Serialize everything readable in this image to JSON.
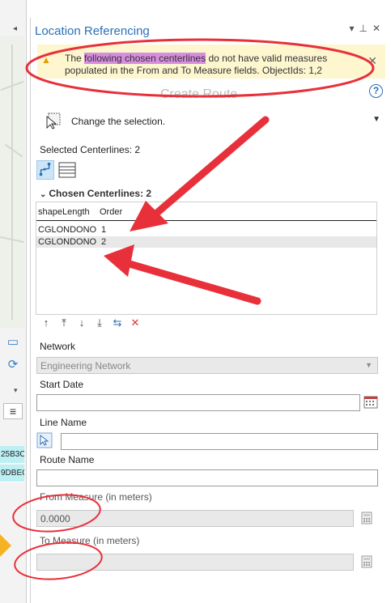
{
  "left_strip": {
    "cyan_rows": [
      "25B3C",
      "9DBEC"
    ]
  },
  "panel": {
    "title": "Location Referencing",
    "title_buttons": "▾ ᵖ ✕",
    "warning": {
      "text_pre": "The ",
      "text_highlight": "following chosen centerlines",
      "text_post": " do not have valid measures populated in the From and To Measure fields. ObjectIds: 1,2",
      "close": "✕"
    },
    "subtitle": "Create Route",
    "help": "?",
    "change_selection_label": "Change the selection.",
    "selected_centerlines": "Selected Centerlines: 2",
    "chosen_header": "Chosen Centerlines: 2",
    "table": {
      "columns": [
        "shapeLength",
        "Order"
      ],
      "rows": [
        {
          "shapeLength": "CGLONDONO",
          "order": "1"
        },
        {
          "shapeLength": "CGLONDONO",
          "order": "2"
        }
      ]
    },
    "tools": [
      "↑",
      "⤒",
      "↓",
      "⤓",
      "⇆",
      "✕"
    ],
    "network_label": "Network",
    "network_value": "Engineering Network",
    "start_date_label": "Start Date",
    "start_date_value": "",
    "line_name_label": "Line Name",
    "line_name_value": "",
    "route_name_label": "Route Name",
    "route_name_value": "",
    "from_measure_label": "From Measure (in meters)",
    "from_measure_value": "0.0000",
    "to_measure_label": "To Measure (in meters)",
    "to_measure_value": ""
  },
  "colors": {
    "accent": "#2b6fb6",
    "warning_bg": "#fdf6cf",
    "highlight": "#d88ee0",
    "annotation_red": "#e8303a"
  }
}
